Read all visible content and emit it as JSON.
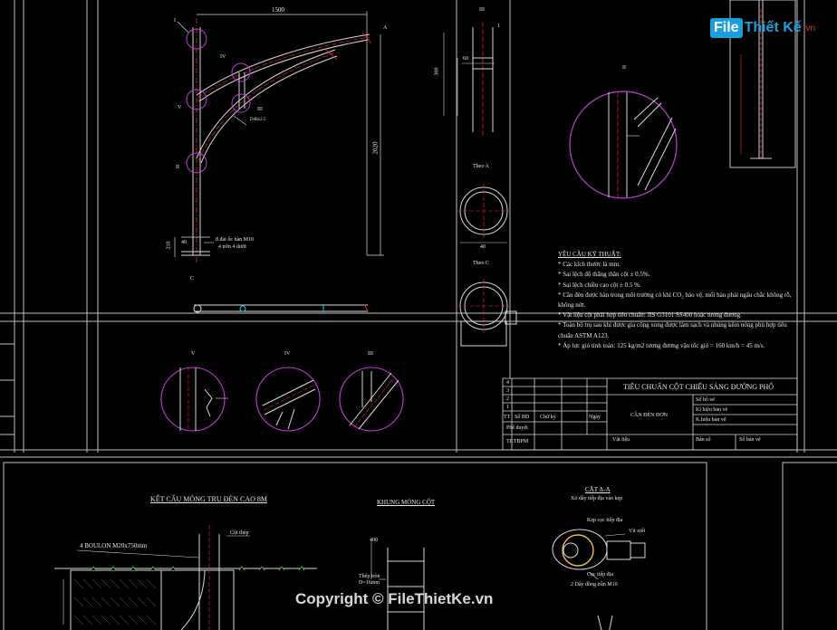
{
  "watermark": {
    "logo_file": "File",
    "logo_rest": "Thiết Kế",
    "logo_domain": ".vn",
    "copyright": "Copyright © FileThietKe.vn"
  },
  "pole_drawing": {
    "dim_width": "1500",
    "dim_height": "2020",
    "dim_base": "210",
    "dim_40": "40",
    "bolt_note_1": "8 đai ốc hàn M10",
    "bolt_note_2": "4 trên 4 dưới",
    "label_I": "I",
    "label_II": "II",
    "label_III": "III",
    "label_IV": "IV",
    "label_V": "V",
    "label_A": "A",
    "label_C": "C",
    "small_dim": "D48x2.5"
  },
  "detail_III_top": {
    "title": "III",
    "dim_300": "300",
    "dim_60": "60",
    "label_1": "1"
  },
  "sections": {
    "theo_a": "Theo A",
    "theo_c": "Theo C",
    "detail_ii": "II",
    "detail_v": "V",
    "detail_iv": "IV",
    "detail_iii": "III",
    "dim_40": "40"
  },
  "notes": {
    "title": "YÊU CẦU KỸ THUẬT:",
    "lines": [
      "* Các kích thước là mm.",
      "* Sai lệch độ thẳng thân cột ± 0.5%.",
      "* Sai lệch chiều cao cột ± 0.5 %.",
      "* Cần đèn được hàn trong môi trường có khí CO₂ bảo vệ, mối hàn phải ngấu chắc không rỗ,",
      "không nứt.",
      "* Vật liệu cột phải hợp tiêu chuẩn: JIS G3101 SS400 hoặc tương đương.",
      "* Toàn bộ trụ sau khi được gia công xong được làm sạch và nhúng kẽm nóng phù hợp tiêu",
      "chuẩn ASTM A123.",
      "* Áp lực gió tính toán: 125 kg/m2 tương đương vận tốc gió = 160 km/h = 45 m/s."
    ]
  },
  "title_block": {
    "main_title": "TIÊU CHUẨN CỘT CHIẾU SÁNG ĐƯỜNG PHỐ",
    "sub_title": "CẦN ĐÈN ĐƠN",
    "rows_left": [
      "4",
      "3",
      "2",
      "1"
    ],
    "col_tt": "TT",
    "col_so_bo": "Số BĐ",
    "col_chu_ky": "Chữ ký",
    "col_ngay": "Ngày",
    "phe_duyet": "Phê duyệt",
    "tp_tbpm": "TP.TBPM",
    "so_ho_so": "Số hồ sơ",
    "ki_hieu_ban_ve": "Kí hiệu bản vẽ",
    "ki_hieu_ban_ve_2": "K.hiệu bản vẽ",
    "vat_lieu": "Vật liệu",
    "ban_so": "Bản số",
    "so_ban_ve": "Số bản vẽ"
  },
  "foundation": {
    "title": "KẾT CẤU MÓNG TRỤ ĐÈN CAO 8M",
    "bolt_label": "4 BOULON M20x750mm",
    "col_thep": "Cột thép",
    "khung_title": "KHUNG MÓNG CỘT",
    "thep_tron": "Thép tròn",
    "d_label": "D=16mm",
    "dim_400": "400"
  },
  "cut_aa": {
    "title": "CẮT A-A",
    "subtitle": "Xỏ dây tiếp địa vào kẹp",
    "kep_coc": "Kẹp cọc tiếp địa",
    "vit_xiet": "Vít xiết",
    "coc_tiep_dia": "Cọc tiếp địa",
    "day_dong": "2 Dây đồng trần M10"
  }
}
